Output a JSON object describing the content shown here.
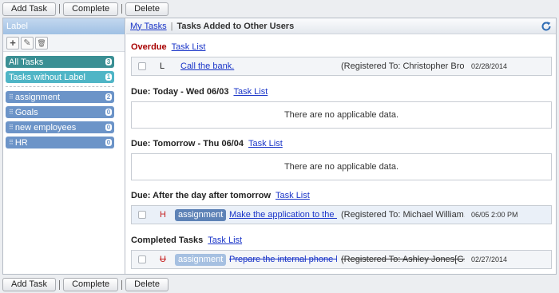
{
  "toolbar": {
    "add_task": "Add Task",
    "complete": "Complete",
    "delete": "Delete"
  },
  "sidebar": {
    "header": "Label",
    "tools": {
      "add": "+",
      "edit": "✎",
      "delete": "🗑"
    },
    "labels": [
      {
        "name": "All Tasks",
        "count": "3"
      },
      {
        "name": "Tasks without Label",
        "count": "1"
      },
      {
        "name": "assignment",
        "count": "2"
      },
      {
        "name": "Goals",
        "count": "0"
      },
      {
        "name": "new employees",
        "count": "0"
      },
      {
        "name": "HR",
        "count": "0"
      }
    ]
  },
  "main": {
    "breadcrumb_link": "My Tasks",
    "breadcrumb_sep": "|",
    "title": "Tasks Added to Other Users",
    "task_list_link": "Task List",
    "sections": {
      "overdue": {
        "title": "Overdue",
        "task": {
          "priority": "L",
          "name": "Call the bank.",
          "registered": "(Registered To: Christopher Bro...",
          "date": "02/28/2014"
        }
      },
      "today": {
        "title": "Due: Today - Wed 06/03",
        "empty": "There are no applicable data."
      },
      "tomorrow": {
        "title": "Due: Tomorrow - Thu 06/04",
        "empty": "There are no applicable data."
      },
      "after": {
        "title": "Due: After the day after tomorrow",
        "task": {
          "priority": "H",
          "label": "assignment",
          "name": "Make the application to the l...",
          "registered": "(Registered To: Michael William...",
          "date": "06/05 2:00 PM"
        }
      },
      "completed": {
        "title": "Completed Tasks",
        "task": {
          "priority": "U",
          "label": "assignment",
          "name": "Prepare the internal phone l...",
          "registered": "(Registered To: Ashley Jones[G...",
          "date": "02/27/2014"
        }
      }
    }
  },
  "colors": {
    "accent": "#1a35c8",
    "overdue": "#a80000",
    "label_all": "#3a8f94",
    "label_nolabel": "#4fb5c6",
    "label_user": "#6c94c8"
  },
  "icons": [
    "plus-icon",
    "pencil-icon",
    "trash-icon",
    "refresh-icon",
    "grip-icon"
  ]
}
